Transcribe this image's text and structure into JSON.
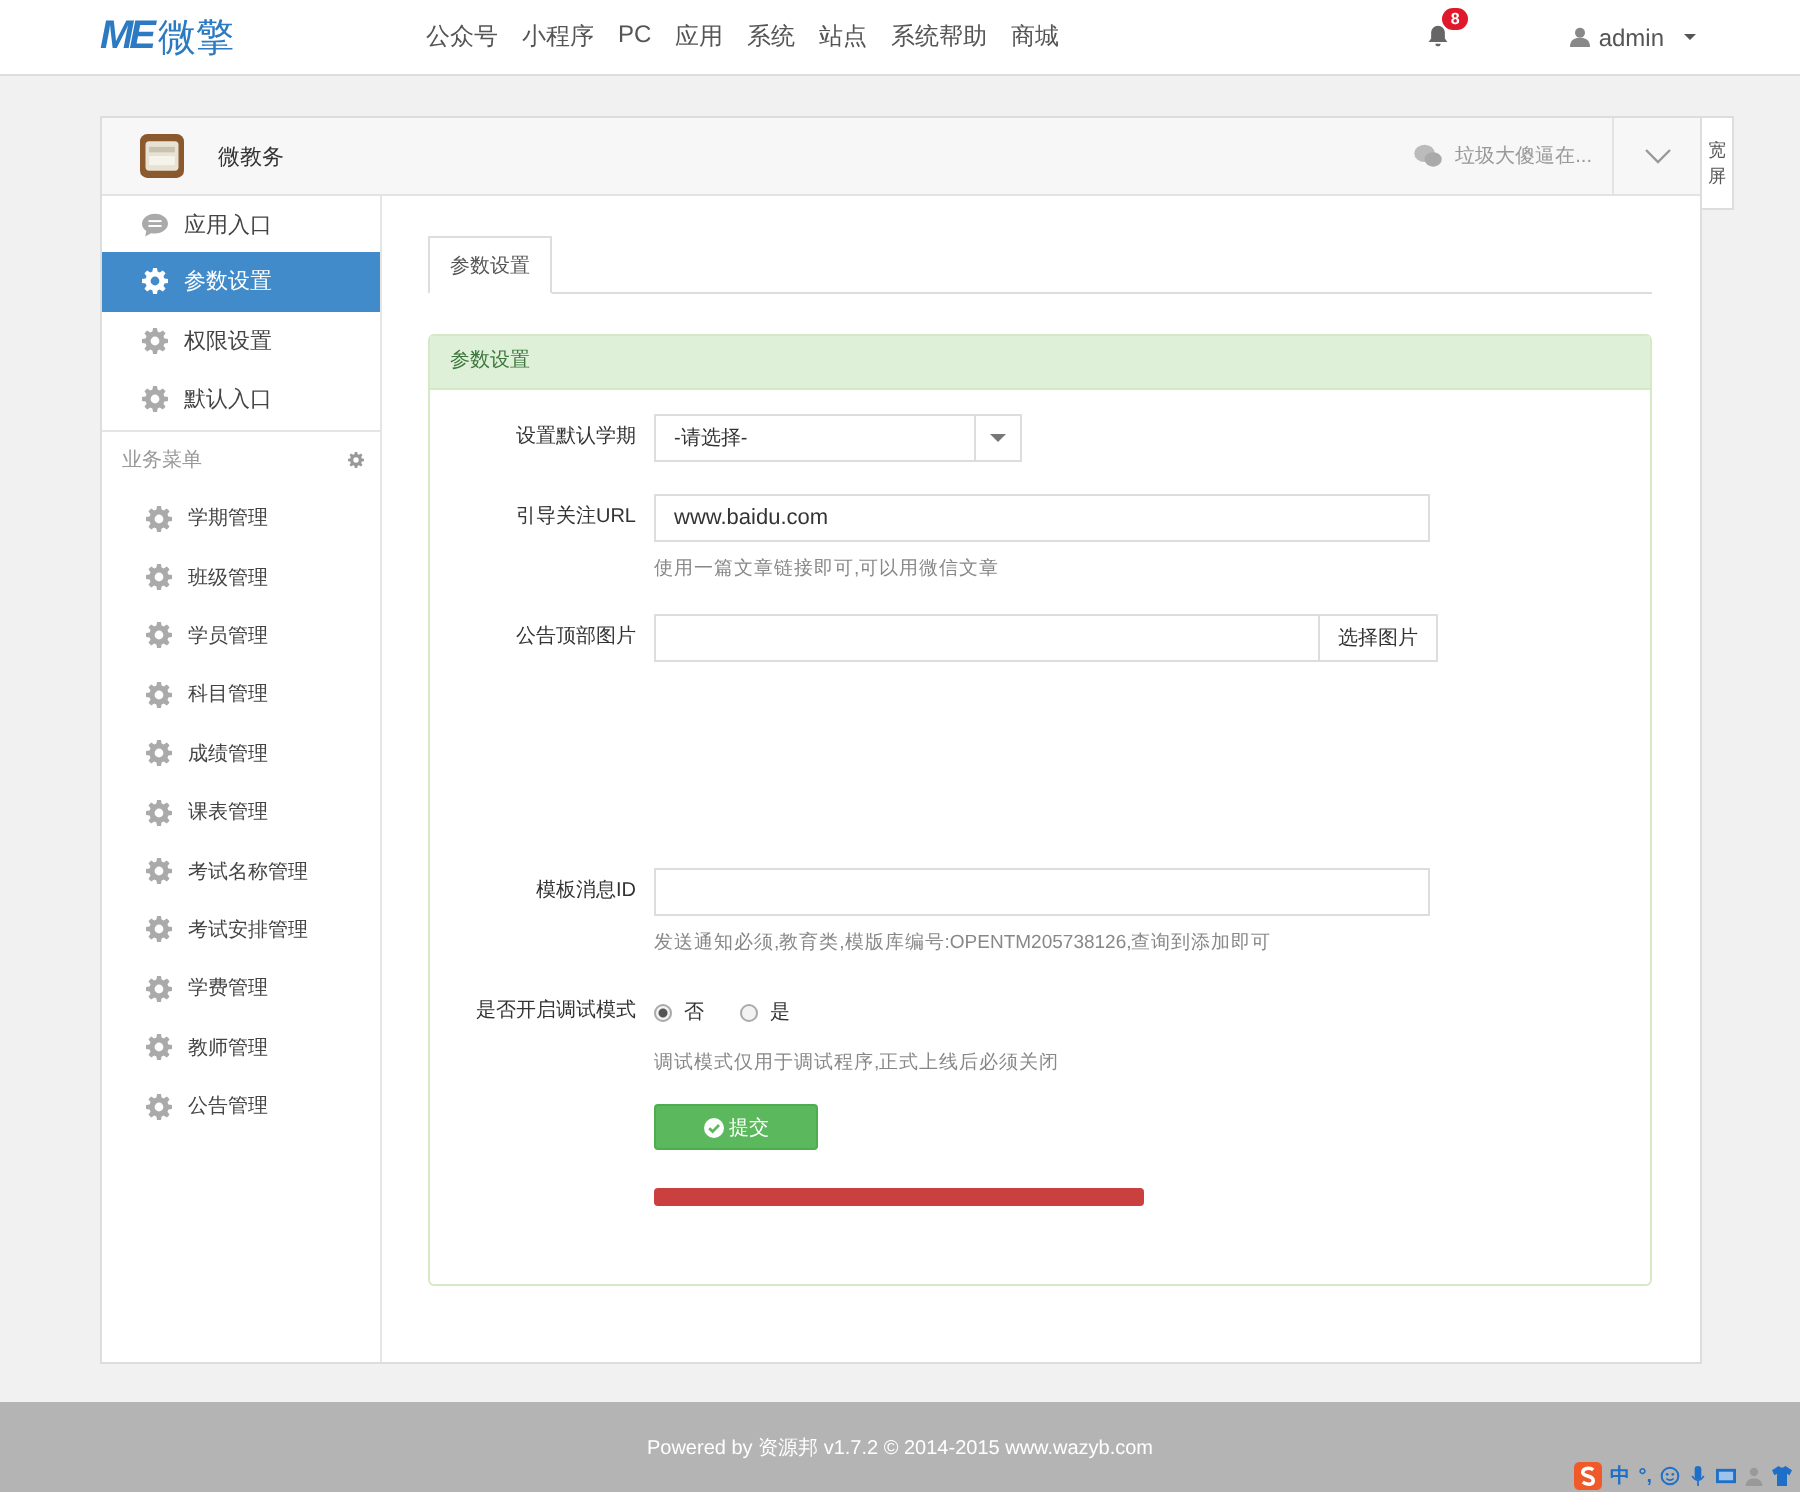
{
  "header": {
    "logo_mark": "ME",
    "logo_text": "微擎",
    "nav": [
      "公众号",
      "小程序",
      "PC",
      "应用",
      "系统",
      "站点",
      "系统帮助",
      "商城"
    ],
    "notification_count": "8",
    "user": "admin"
  },
  "module": {
    "title": "微教务",
    "status": "垃圾大傻逼在...",
    "wide_screen": "宽屏"
  },
  "sidebar": {
    "items": [
      {
        "label": "应用入口",
        "kind": "chat",
        "selected": false
      },
      {
        "label": "参数设置",
        "kind": "gear",
        "selected": true
      },
      {
        "label": "权限设置",
        "kind": "gear",
        "selected": false
      },
      {
        "label": "默认入口",
        "kind": "gear",
        "selected": false
      }
    ],
    "section": "业务菜单",
    "menu": [
      "学期管理",
      "班级管理",
      "学员管理",
      "科目管理",
      "成绩管理",
      "课表管理",
      "考试名称管理",
      "考试安排管理",
      "学费管理",
      "教师管理",
      "公告管理"
    ]
  },
  "tabs": [
    {
      "label": "参数设置",
      "selected": true
    }
  ],
  "panel": {
    "title": "参数设置",
    "fields": [
      {
        "kind": "select",
        "label": "设置默认学期",
        "value": "-请选择-"
      },
      {
        "kind": "text",
        "label": "引导关注URL",
        "value": "www.baidu.com",
        "help": "使用一篇文章链接即可,可以用微信文章"
      },
      {
        "kind": "image",
        "label": "公告顶部图片",
        "button": "选择图片"
      },
      {
        "kind": "text",
        "label": "模板消息ID",
        "help": "发送通知必须,教育类,模版库编号:OPENTM205738126,查询到添加即可"
      },
      {
        "kind": "radio",
        "label": "是否开启调试模式",
        "options": [
          {
            "label": "否",
            "selected": true
          },
          {
            "label": "是",
            "selected": false
          }
        ],
        "help": "调试模式仅用于调试程序,正式上线后必须关闭"
      }
    ],
    "submit": "提交"
  },
  "footer": "Powered by 资源邦 v1.7.2 © 2014-2015 www.wazyb.com",
  "ime": {
    "mode": "中",
    "punctuation": "°,"
  }
}
